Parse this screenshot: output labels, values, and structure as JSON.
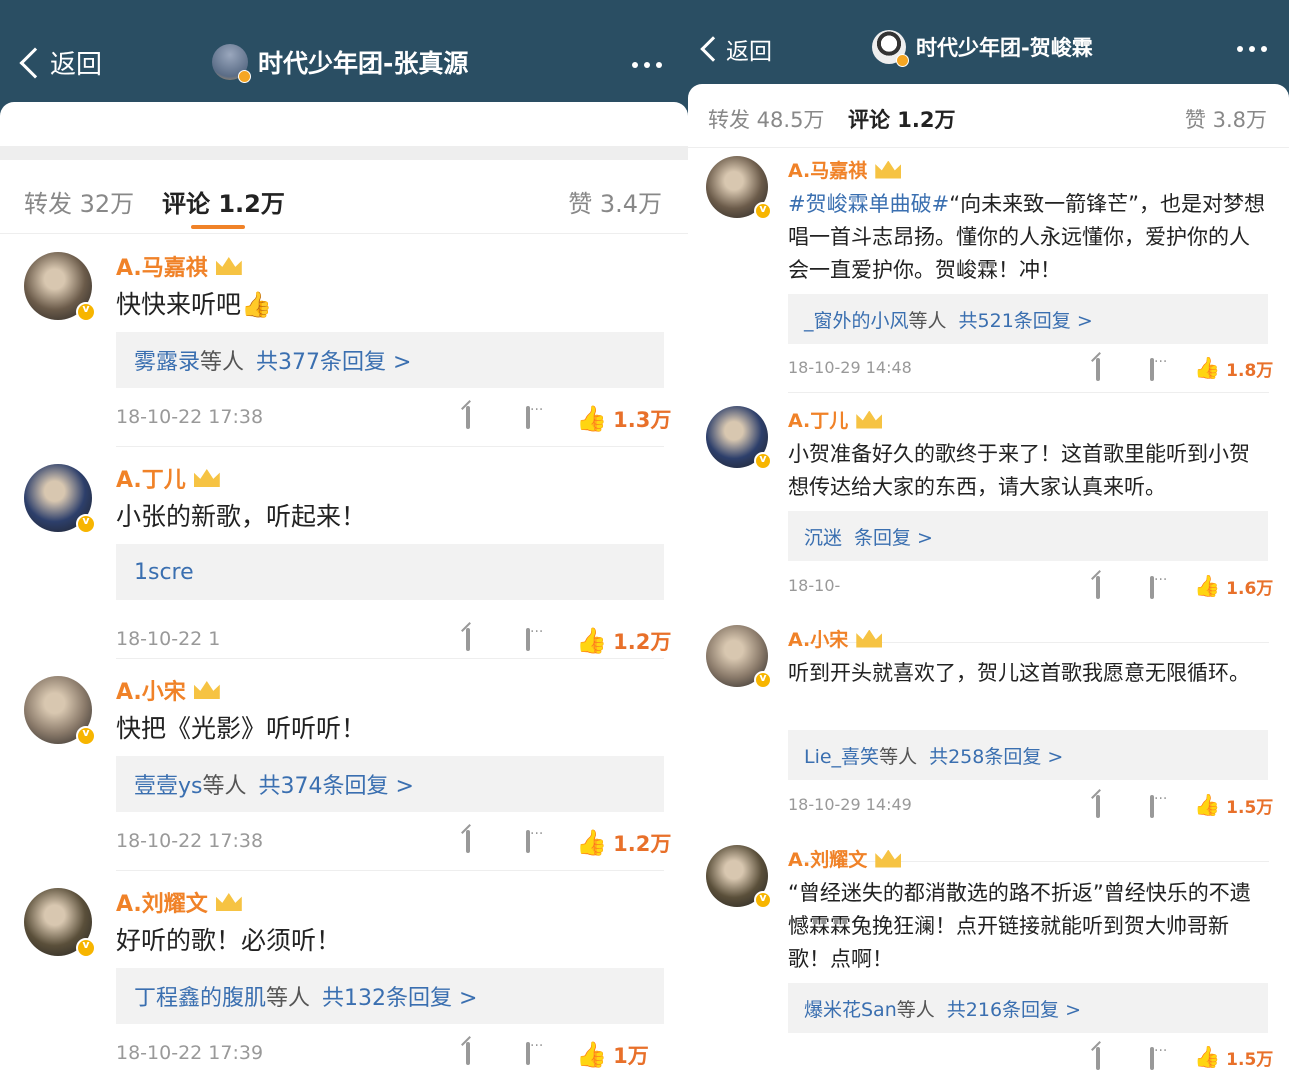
{
  "left": {
    "header": {
      "back_label": "返回",
      "title": "时代少年团-张真源"
    },
    "tabs": {
      "repost": "转发 32万",
      "comments": "评论 1.2万",
      "likes": "赞 3.4万"
    },
    "comments": [
      {
        "user": "A.马嘉祺",
        "text": "快快来听吧👍",
        "reply_names": "雾露录",
        "reply_etc": "等人",
        "reply_count": "共377条回复 >",
        "time": "18-10-22 17:38",
        "likes": "1.3万",
        "avatar_color": "#6b5b4a"
      },
      {
        "user": "A.丁儿",
        "text": "小张的新歌，听起来！",
        "reply_names": "1scre",
        "reply_etc": "",
        "reply_count": "",
        "time": "18-10-22 1",
        "likes": "1.2万",
        "avatar_color": "#2d3f6b"
      },
      {
        "user": "A.小宋",
        "text": "快把《光影》听听听！",
        "reply_names": "壹壹ys",
        "reply_etc": "等人",
        "reply_count": "共374条回复 >",
        "time": "18-10-22 17:38",
        "likes": "1.2万",
        "avatar_color": "#8a7a6a"
      },
      {
        "user": "A.刘耀文",
        "text": "好听的歌！必须听！",
        "reply_names": "丁程鑫的腹肌",
        "reply_etc": "等人",
        "reply_count": "共132条回复 >",
        "time": "18-10-22 17:39",
        "likes": "1万",
        "avatar_color": "#5a4f3a"
      }
    ]
  },
  "right": {
    "header": {
      "back_label": "返回",
      "title": "时代少年团-贺峻霖"
    },
    "tabs": {
      "repost": "转发 48.5万",
      "comments": "评论 1.2万",
      "likes": "赞 3.8万"
    },
    "comments": [
      {
        "user": "A.马嘉祺",
        "hashtag": "#贺峻霖单曲破#",
        "text": "“向未来致一箭锋芒”，也是对梦想唱一首斗志昂扬。懂你的人永远懂你，爱护你的人会一直爱护你。贺峻霖！冲！",
        "reply_names": "_窗外的小风",
        "reply_etc": "等人",
        "reply_count": "共521条回复 >",
        "time": "18-10-29 14:48",
        "likes": "1.8万",
        "avatar_color": "#6b5b4a"
      },
      {
        "user": "A.丁儿",
        "hashtag": "",
        "text": "小贺准备好久的歌终于来了！这首歌里能听到小贺想传达给大家的东西，请大家认真来听。",
        "reply_names": "沉迷",
        "reply_etc": "",
        "reply_count": "条回复 >",
        "time": "18-10-",
        "likes": "1.6万",
        "avatar_color": "#2d3f6b"
      },
      {
        "user": "A.小宋",
        "hashtag": "",
        "text": "听到开头就喜欢了，贺儿这首歌我愿意无限循环。",
        "reply_names": "Lie_喜笑",
        "reply_etc": "等人",
        "reply_count": "共258条回复 >",
        "time": "18-10-29 14:49",
        "likes": "1.5万",
        "avatar_color": "#8a7a6a"
      },
      {
        "user": "A.刘耀文",
        "hashtag": "",
        "text": "“曾经迷失的都消散选的路不折返”曾经快乐的不遗憾霖霖兔挽狂澜！点开链接就能听到贺大帅哥新歌！点啊！",
        "reply_names": "爆米花San",
        "reply_etc": "等人",
        "reply_count": "共216条回复 >",
        "time": "",
        "likes": "1.5万",
        "avatar_color": "#5a4f3a"
      }
    ]
  },
  "icons": {
    "back": "chevron-left-icon",
    "more": "more-dots-icon",
    "crown": "crown-icon",
    "share": "share-icon",
    "reply": "comment-icon",
    "like": "thumbs-up-icon",
    "verified": "verified-badge-icon"
  },
  "colors": {
    "header": "#2a4e63",
    "username": "#f08228",
    "link": "#3a6fb0",
    "like": "#e8702a",
    "reply_bg": "#f2f2f2"
  }
}
